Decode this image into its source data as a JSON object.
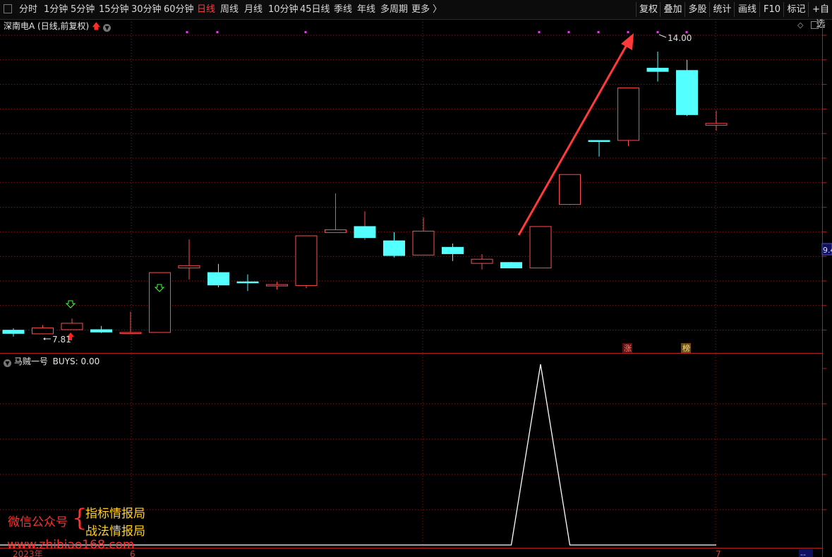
{
  "toolbar": {
    "periods": [
      {
        "label": "分时",
        "name": "period-fenshi"
      },
      {
        "label": "1分钟",
        "name": "period-1min"
      },
      {
        "label": "5分钟",
        "name": "period-5min"
      },
      {
        "label": "15分钟",
        "name": "period-15min"
      },
      {
        "label": "30分钟",
        "name": "period-30min"
      },
      {
        "label": "60分钟",
        "name": "period-60min"
      },
      {
        "label": "日线",
        "name": "period-daily"
      },
      {
        "label": "周线",
        "name": "period-weekly"
      },
      {
        "label": "月线",
        "name": "period-monthly"
      },
      {
        "label": "10分钟",
        "name": "period-10min"
      },
      {
        "label": "45日线",
        "name": "period-45day"
      },
      {
        "label": "季线",
        "name": "period-quarter"
      },
      {
        "label": "年线",
        "name": "period-year"
      },
      {
        "label": "多周期",
        "name": "period-multi"
      },
      {
        "label": "更多 〉",
        "name": "period-more"
      }
    ],
    "active_period": "日线",
    "tools": [
      "复权",
      "叠加",
      "多股",
      "统计",
      "画线",
      "F10",
      "标记",
      "+自选"
    ]
  },
  "main_panel": {
    "stock_name": "深南电A",
    "mode": "(日线,前复权)",
    "price_tag": "9.4",
    "high_label": "14.00",
    "low_label": "7.81",
    "badges": {
      "zhang": "涨",
      "bang": "榜"
    }
  },
  "indicator_panel": {
    "name": "马贼一号",
    "value_label": "BUYS: 0.00"
  },
  "axis": {
    "year": "2023年",
    "month_june": "6",
    "month_july": "7",
    "corner": "--"
  },
  "watermark": {
    "wechat": "微信公众号",
    "brace": "{",
    "line1": "指标情报局",
    "line2": "战法情报局",
    "url": "www.zhibiao168.com"
  },
  "colors": {
    "up": "#ff4d4d",
    "down": "#54ffff",
    "grid": "#8a1a1a",
    "active": "#ff3b3b"
  },
  "chart_data": {
    "type": "candlestick",
    "ylim": [
      7.5,
      14.4
    ],
    "candles": [
      {
        "o": 7.95,
        "c": 7.88,
        "h": 7.99,
        "l": 7.81
      },
      {
        "o": 7.87,
        "c": 8.0,
        "h": 8.06,
        "l": 7.86
      },
      {
        "o": 7.96,
        "c": 8.1,
        "h": 8.2,
        "l": 7.96
      },
      {
        "o": 7.96,
        "c": 7.91,
        "h": 8.04,
        "l": 7.89
      },
      {
        "o": 7.89,
        "c": 7.9,
        "h": 8.35,
        "l": 7.88
      },
      {
        "o": 7.9,
        "c": 9.2,
        "h": 9.2,
        "l": 7.9
      },
      {
        "o": 9.3,
        "c": 9.35,
        "h": 9.92,
        "l": 9.05
      },
      {
        "o": 9.2,
        "c": 8.93,
        "h": 9.39,
        "l": 8.88
      },
      {
        "o": 9.0,
        "c": 8.99,
        "h": 9.16,
        "l": 8.8
      },
      {
        "o": 8.91,
        "c": 8.94,
        "h": 9.0,
        "l": 8.83
      },
      {
        "o": 8.92,
        "c": 10.0,
        "h": 10.0,
        "l": 8.86
      },
      {
        "o": 10.07,
        "c": 10.13,
        "h": 10.92,
        "l": 10.07
      },
      {
        "o": 10.2,
        "c": 9.96,
        "h": 10.53,
        "l": 9.91
      },
      {
        "o": 9.89,
        "c": 9.57,
        "h": 10.08,
        "l": 9.53
      },
      {
        "o": 9.58,
        "c": 10.1,
        "h": 10.4,
        "l": 9.58
      },
      {
        "o": 9.75,
        "c": 9.61,
        "h": 9.83,
        "l": 9.45
      },
      {
        "o": 9.4,
        "c": 9.49,
        "h": 9.6,
        "l": 9.27
      },
      {
        "o": 9.42,
        "c": 9.3,
        "h": 9.43,
        "l": 9.3
      },
      {
        "o": 9.3,
        "c": 10.2,
        "h": 10.2,
        "l": 9.3
      },
      {
        "o": 10.68,
        "c": 11.33,
        "h": 11.33,
        "l": 10.67
      },
      {
        "o": 12.07,
        "c": 12.06,
        "h": 12.07,
        "l": 11.72
      },
      {
        "o": 12.07,
        "c": 13.21,
        "h": 13.21,
        "l": 11.95
      },
      {
        "o": 13.64,
        "c": 13.57,
        "h": 14.0,
        "l": 13.35
      },
      {
        "o": 13.59,
        "c": 12.63,
        "h": 13.82,
        "l": 12.6
      },
      {
        "o": 12.4,
        "c": 12.44,
        "h": 12.72,
        "l": 12.28
      }
    ],
    "indicator": {
      "name": "BUYS",
      "ylim": [
        0,
        1
      ],
      "values": [
        0,
        0,
        0,
        0,
        0,
        0,
        0,
        0,
        0,
        0,
        0,
        0,
        0,
        0,
        0,
        0,
        0,
        0,
        1,
        0,
        0,
        0,
        0,
        0,
        0
      ]
    }
  }
}
